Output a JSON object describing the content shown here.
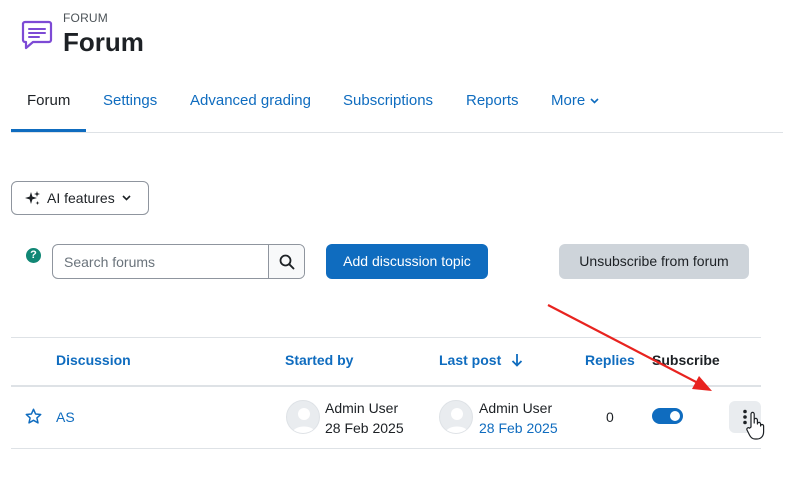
{
  "header": {
    "kicker": "FORUM",
    "title": "Forum"
  },
  "nav": {
    "tabs": [
      {
        "label": "Forum",
        "active": true
      },
      {
        "label": "Settings"
      },
      {
        "label": "Advanced grading"
      },
      {
        "label": "Subscriptions"
      },
      {
        "label": "Reports"
      },
      {
        "label": "More"
      }
    ]
  },
  "ai_features": {
    "label": "AI features",
    "icon": "sparkles-icon"
  },
  "help": {
    "glyph": "?"
  },
  "search": {
    "placeholder": "Search forums",
    "value": ""
  },
  "actions": {
    "add_discussion": "Add discussion topic",
    "unsubscribe": "Unsubscribe from forum"
  },
  "table": {
    "headers": {
      "discussion": "Discussion",
      "started_by": "Started by",
      "last_post": "Last post",
      "replies": "Replies",
      "subscribe": "Subscribe"
    },
    "rows": [
      {
        "subject": "AS",
        "started_by": {
          "name": "Admin User",
          "date": "28 Feb 2025"
        },
        "last_post": {
          "name": "Admin User",
          "date": "28 Feb 2025"
        },
        "replies": "0",
        "subscribed": true
      }
    ]
  },
  "colors": {
    "brand": "#0f6cbf",
    "help": "#118775",
    "annotation_arrow": "#e8231f"
  }
}
